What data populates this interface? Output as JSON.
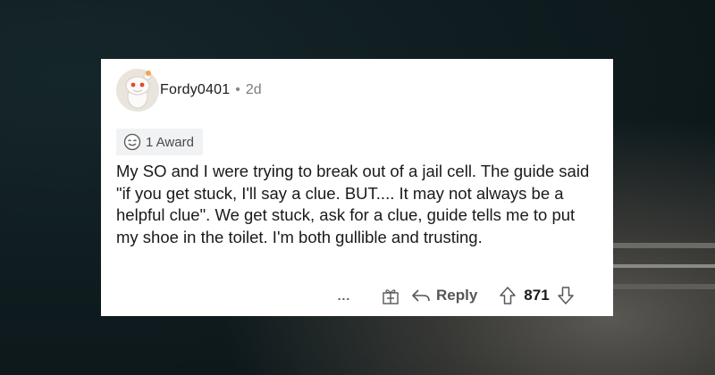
{
  "comment": {
    "username": "Fordy0401",
    "separator": "•",
    "age": "2d",
    "award_label": "1 Award",
    "body": "My SO and I were trying to break out of a jail cell. The guide said \"if you get stuck, I'll say a clue. BUT.... It may not always be a helpful clue\". We get stuck, ask for a clue, guide tells me to put my shoe in the toilet. I'm both gullible and trusting."
  },
  "actions": {
    "more_label": "...",
    "reply_label": "Reply",
    "score": "871"
  },
  "icons": {
    "award": "award-icon",
    "gift": "gift-icon",
    "reply": "reply-arrow-icon",
    "upvote": "upvote-arrow-icon",
    "downvote": "downvote-arrow-icon"
  },
  "colors": {
    "card_bg": "#ffffff",
    "award_bg": "#f1f2f3",
    "text": "#1a1a1b",
    "muted": "#878a8c"
  }
}
